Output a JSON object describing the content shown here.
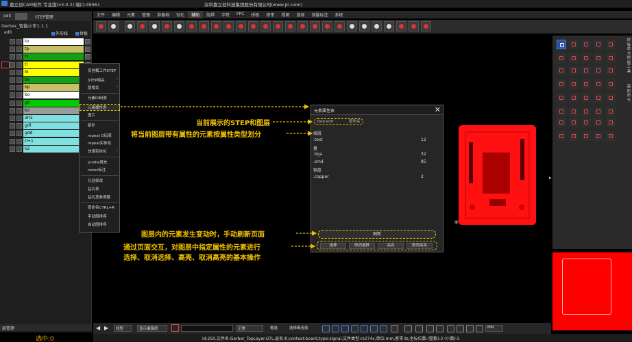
{
  "app": {
    "title": "嘉立创CAM软件 专业版(v3.0.2) 端口:49961",
    "company": "深圳嘉立创科技集团股份有限公司(www.jlc.com)",
    "menu": [
      "文件",
      "编辑",
      "元素",
      "管理",
      "准备档",
      "钻孔",
      "辅助",
      "阻焊",
      "字符",
      "FPC",
      "拼板",
      "修审",
      "视图",
      "选择",
      "测量标注",
      "系统"
    ],
    "menu_active": "辅助"
  },
  "left_panel": {
    "tabs": [
      "edit",
      "STEP管理"
    ],
    "job": "Gerber_智能小车1.1.1",
    "step": "edit",
    "checkbox_outline": "外形线",
    "checkbox_panel": "拼板",
    "layers": [
      {
        "name": "to",
        "color": "#ffffff"
      },
      {
        "name": "tp",
        "color": "#c8c064"
      },
      {
        "name": "ts",
        "color": "#14a014"
      },
      {
        "name": "tl",
        "color": "#ffff00"
      },
      {
        "name": "bl",
        "color": "#ffff00"
      },
      {
        "name": "bs",
        "color": "#14a014"
      },
      {
        "name": "bp",
        "color": "#c8c064"
      },
      {
        "name": "bo",
        "color": "#ffffff"
      },
      {
        "name": "gtl",
        "color": "#00cc00"
      },
      {
        "name": "ko",
        "color": "#9a9a9a"
      },
      {
        "name": "drl2",
        "color": "#80e0e0"
      },
      {
        "name": "gdl",
        "color": "#80e0e0"
      },
      {
        "name": "gdd",
        "color": "#80e0e0"
      },
      {
        "name": "tl+1",
        "color": "#80e0e0"
      },
      {
        "name": "k2",
        "color": "#80e0e0"
      }
    ],
    "footer_tab": "层管理",
    "selected_count": "选中:0"
  },
  "context_menu": {
    "items": [
      "仅挂载工作STEP",
      "STEP相关",
      "层相关",
      "元素ID码表",
      "元素属性表",
      "图片",
      "拓扑",
      "repeat D码表",
      "repeat实体化",
      "快速实体化",
      "profile填充",
      "notes标注",
      "孔径修改",
      "钻孔表",
      "钻孔宽参调整",
      "层命名CTRL+R",
      "手动层排序",
      "自动层排序"
    ],
    "highlighted": "元素属性表"
  },
  "dialog": {
    "title": "元素属性表",
    "step_field": "step:edit",
    "step_btn": "层命名",
    "rows": [
      {
        "label": "线段",
        "value": ""
      },
      {
        "label": ".text",
        "value": "12"
      },
      {
        "label": "盘",
        "value": ""
      },
      {
        "label": ".bga",
        "value": "32"
      },
      {
        "label": ".smd",
        "value": "85"
      },
      {
        "label": "铜皮",
        "value": ""
      },
      {
        "label": ".copper",
        "value": "2"
      }
    ],
    "refresh": "刷新",
    "buttons": [
      "选择",
      "取消选择",
      "高亮",
      "取消高亮"
    ]
  },
  "annotations": {
    "a1": "当前展示的STEP和图层",
    "a2": "将当前图层带有属性的元素按属性类型划分",
    "a3": "图层内的元素发生变动时，手动刷新页面",
    "a4": "通过页面交互，对图层中指定属性的元素进行",
    "a5": "选择、取消选择、高亮、取消高亮的基本操作"
  },
  "right_panel": {
    "labels": [
      "拼板命令",
      "拼板工具",
      "高阶命令"
    ]
  },
  "bottom": {
    "zoom": "线型",
    "search_btn": "显示编辑层",
    "mode": "正常",
    "frame": "框选",
    "cross": "选择离连接",
    "unit": "MM",
    "status": "id:250,文件名:Gerber_TopLayer.GTL,层名:tl,context:board,type:signal,文件类型:rs274x,单位:mm,客零:tz,坐标位数:(整数):3 (小数):5"
  },
  "colors": {
    "accent": "#f0c000",
    "board": "#ff1111",
    "highlight": "#3a7bd5"
  }
}
